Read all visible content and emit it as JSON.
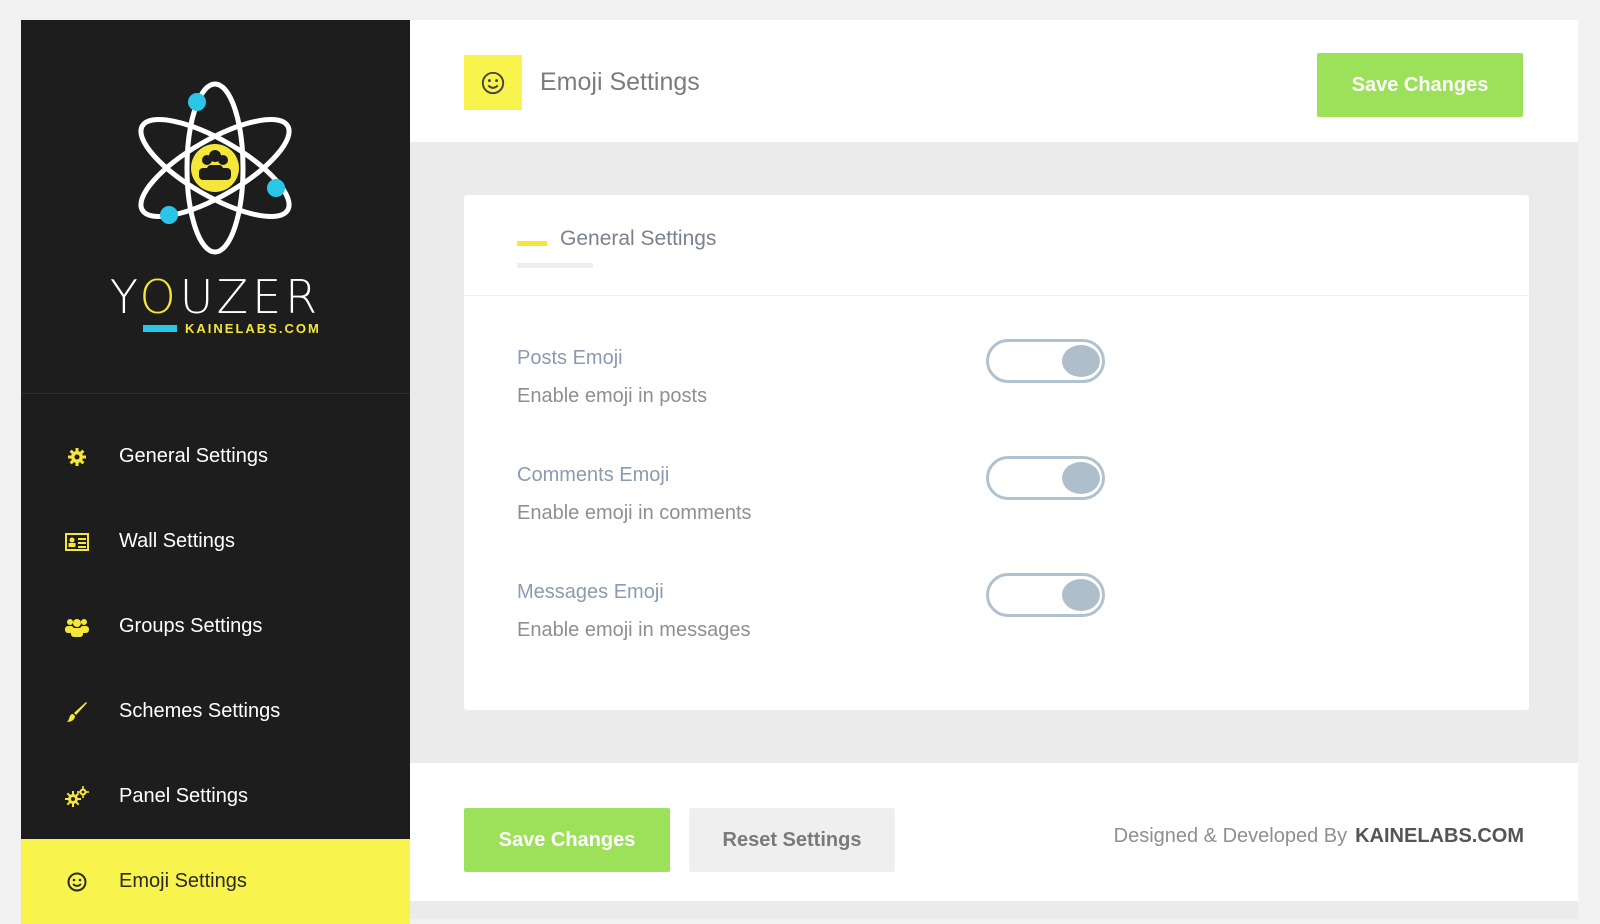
{
  "brand": {
    "name_pre": "Y",
    "name_o": "O",
    "name_post": "UZER",
    "sub": "KAINELABS.COM"
  },
  "sidebar": {
    "items": [
      {
        "label": "General Settings",
        "icon": "gear-icon"
      },
      {
        "label": "Wall Settings",
        "icon": "id-card-icon"
      },
      {
        "label": "Groups Settings",
        "icon": "users-icon"
      },
      {
        "label": "Schemes Settings",
        "icon": "paintbrush-icon"
      },
      {
        "label": "Panel Settings",
        "icon": "cogs-icon"
      },
      {
        "label": "Emoji Settings",
        "icon": "smile-icon",
        "active": true
      }
    ]
  },
  "header": {
    "title": "Emoji Settings",
    "icon": "smile-icon",
    "save_label": "Save Changes"
  },
  "card": {
    "title": "General Settings",
    "options": [
      {
        "title": "Posts Emoji",
        "desc": "Enable emoji in posts",
        "enabled": true
      },
      {
        "title": "Comments Emoji",
        "desc": "Enable emoji in comments",
        "enabled": true
      },
      {
        "title": "Messages Emoji",
        "desc": "Enable emoji in messages",
        "enabled": true
      }
    ]
  },
  "footer": {
    "save_label": "Save Changes",
    "reset_label": "Reset Settings",
    "credit_text": "Designed & Developed By",
    "credit_brand": "KAINELABS.COM"
  },
  "colors": {
    "accent_yellow": "#f8f44d",
    "save_green": "#9de05a",
    "sidebar_bg": "#1d1d1d"
  }
}
